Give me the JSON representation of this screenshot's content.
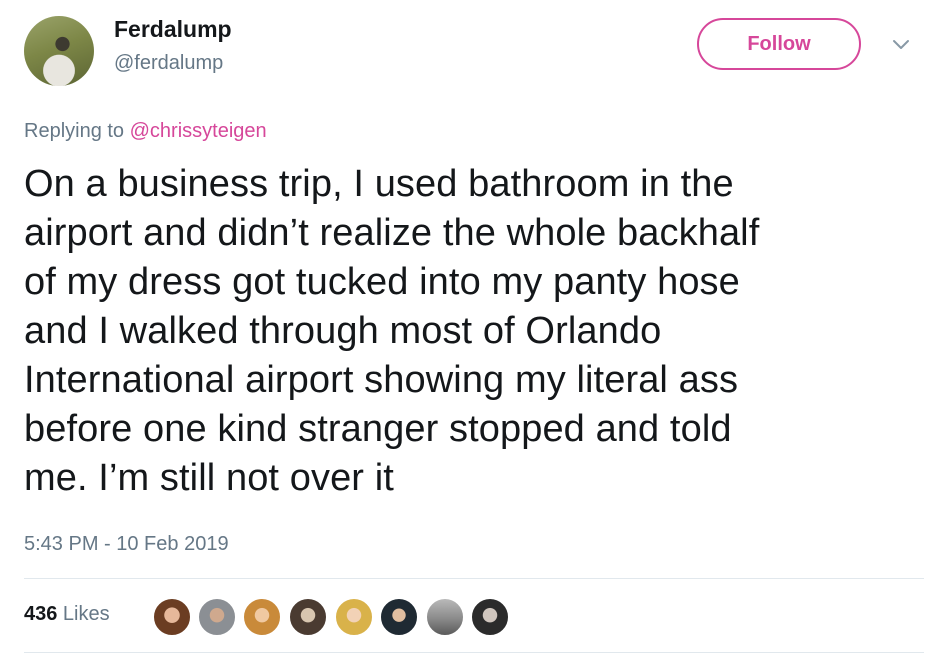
{
  "user": {
    "display_name": "Ferdalump",
    "handle": "@ferdalump"
  },
  "follow_button": {
    "label": "Follow"
  },
  "reply": {
    "prefix": "Replying to ",
    "mention": "@chrissyteigen"
  },
  "tweet": {
    "lines": [
      "On a business trip, I used bathroom in the",
      "airport and didn’t realize the whole backhalf",
      "of my dress got tucked into my panty hose",
      "and I walked through most of Orlando",
      "International airport showing my literal ass",
      "before one kind stranger stopped and told",
      "me. I’m still not over it"
    ],
    "timestamp": "5:43 PM - 10 Feb 2019"
  },
  "likes": {
    "count": "436",
    "label": " Likes"
  },
  "colors": {
    "accent": "#d6479a",
    "secondary_text": "#657786",
    "primary_text": "#14171a",
    "divider": "#e1e8ed"
  },
  "icons": {
    "menu": "chevron-down-icon"
  }
}
